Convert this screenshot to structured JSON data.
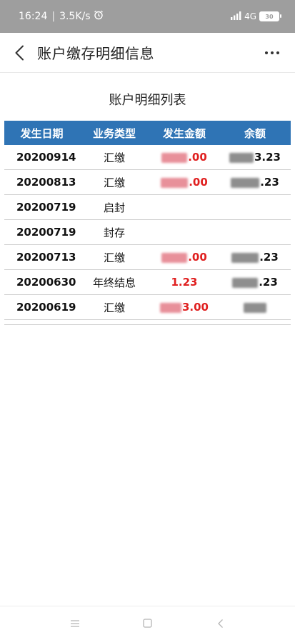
{
  "status_bar": {
    "time": "16:24",
    "speed": "3.5K/s",
    "signal_text": "4G",
    "battery": "30",
    "icons": [
      "alarm-icon",
      "signal-icon",
      "battery-icon"
    ]
  },
  "nav": {
    "title": "账户缴存明细信息",
    "back_icon": "chevron-left-icon",
    "more_icon": "more-dots-icon"
  },
  "list_title": "账户明细列表",
  "table": {
    "headers": [
      "发生日期",
      "业务类型",
      "发生金额",
      "余额"
    ],
    "rows": [
      {
        "date": "20200914",
        "type": "汇缴",
        "amount": ".00",
        "balance": "3.23"
      },
      {
        "date": "20200813",
        "type": "汇缴",
        "amount": ".00",
        "balance": ".23"
      },
      {
        "date": "20200719",
        "type": "启封",
        "amount": "",
        "balance": ""
      },
      {
        "date": "20200719",
        "type": "封存",
        "amount": "",
        "balance": ""
      },
      {
        "date": "20200713",
        "type": "汇缴",
        "amount": ".00",
        "balance": ".23"
      },
      {
        "date": "20200630",
        "type": "年终结息",
        "amount": "1.23",
        "balance": ".23"
      },
      {
        "date": "20200619",
        "type": "汇缴",
        "amount": "3.00",
        "balance": ""
      }
    ]
  },
  "colors": {
    "header_bg": "#2f74b5",
    "amount": "#e02020",
    "status_bar_bg": "#9e9e9e"
  },
  "system_nav": [
    "menu-icon",
    "home-icon",
    "back-icon"
  ]
}
